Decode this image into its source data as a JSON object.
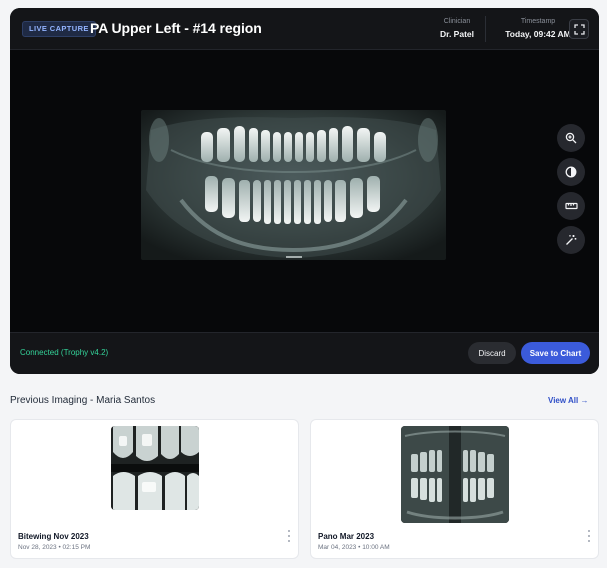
{
  "viewer": {
    "badge": "LIVE CAPTURE",
    "title": "PA Upper Left - #14 region",
    "clinician_label": "Clinician",
    "clinician_value": "Dr. Patel",
    "timestamp_label": "Timestamp",
    "timestamp_value": "Today, 09:42 AM",
    "fullscreen_icon": "fullscreen-icon",
    "image_icon": "panoramic-xray-image",
    "tools": [
      "zoom-in-icon",
      "contrast-icon",
      "ruler-icon",
      "magic-wand-icon"
    ]
  },
  "footer": {
    "status": "Connected (Trophy v4.2)",
    "discard_label": "Discard",
    "save_label": "Save to Chart"
  },
  "history": {
    "title": "Previous Imaging - Maria Santos",
    "view_all": "View All →",
    "cards": [
      {
        "title": "Bitewing Nov 2023",
        "date": "Nov 28, 2023 • 02:15 PM"
      },
      {
        "title": "Pano Mar 2023",
        "date": "Mar 04, 2023 • 10:00 AM"
      }
    ]
  },
  "colors": {
    "accent": "#3b5bdb",
    "status_ok": "#34d399",
    "viewer_bg": "#0b0c0f"
  }
}
